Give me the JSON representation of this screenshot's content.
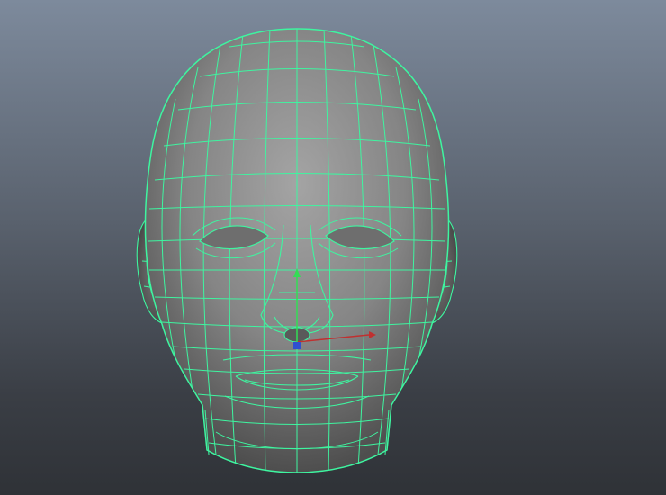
{
  "viewport": {
    "background_top": "#7d8a9c",
    "background_bottom": "#2f3237",
    "wireframe_color": "#3ef5a0",
    "shaded_color": "#8a8a8a",
    "object": "head-mesh",
    "manipulator": {
      "x_axis_color": "#c03030",
      "y_axis_color": "#33dd55",
      "z_axis_color": "#3050d0"
    }
  }
}
